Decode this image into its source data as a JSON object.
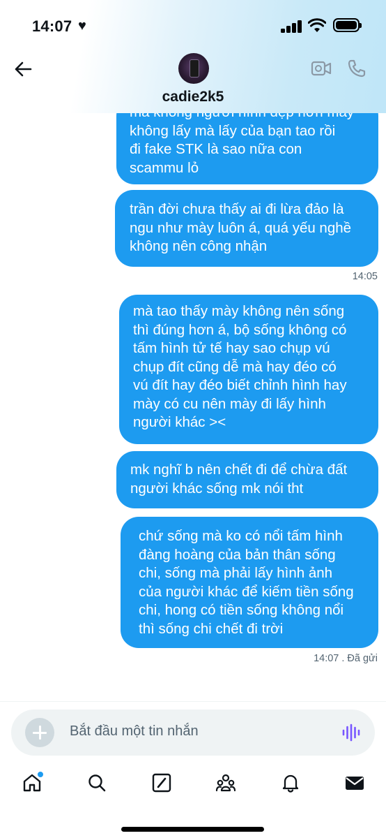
{
  "status_bar": {
    "time": "14:07",
    "heart_icon": "heart-icon",
    "signal_icon": "signal-icon",
    "wifi_icon": "wifi-icon",
    "battery_icon": "battery-icon"
  },
  "header": {
    "back_icon": "arrow-left-icon",
    "username": "cadie2k5",
    "video_icon": "video-call-icon",
    "call_icon": "phone-call-icon"
  },
  "messages": [
    {
      "text": "mà không người hình đẹp hơn mày\nkhông lấy mà lấy của bạn tao rồi\nđi fake STK là sao nữa con\nscammu lỏ"
    },
    {
      "text": "trần đời chưa thấy ai đi lừa đảo là\nngu như mày luôn á, quá yếu nghề\nkhông nên công nhận",
      "timestamp": "14:05"
    },
    {
      "text": "mà tao thấy mày không nên sống\nthì đúng hơn á, bộ sống không có\ntấm hình tử tế hay sao chụp vú\nchụp đít cũng dễ mà hay đéo có\nvú đít hay đéo biết chỉnh hình hay\nmày có cu nên mày đi lấy hình\nngười khác ><"
    },
    {
      "text": "mk nghĩ b nên chết đi để chừa đất\nngười khác sống mk nói tht"
    },
    {
      "text": "chứ sống mà ko có nổi tấm hình\nđàng hoàng của bản thân sống\nchi, sống mà phải lấy hình ảnh\ncủa người khác để kiếm tiền sống\nchi, hong có tiền sống không nổi\nthì sống chi chết đi trời",
      "timestamp": "14:07 . Đã gửi"
    }
  ],
  "composer": {
    "placeholder": "Bắt đầu một tin nhắn",
    "add_icon": "plus-icon",
    "voice_icon": "voice-waveform-icon"
  },
  "tabbar": {
    "items": [
      {
        "name": "home",
        "icon": "home-icon",
        "has_notification": true
      },
      {
        "name": "search",
        "icon": "search-icon"
      },
      {
        "name": "grok",
        "icon": "grok-icon"
      },
      {
        "name": "communities",
        "icon": "communities-icon"
      },
      {
        "name": "notifications",
        "icon": "bell-icon"
      },
      {
        "name": "messages",
        "icon": "envelope-icon"
      }
    ]
  },
  "colors": {
    "bubble": "#1d9bf0",
    "accent": "#1d9bf0",
    "voice_accent": "#7856ff",
    "timestamp": "#536471"
  }
}
